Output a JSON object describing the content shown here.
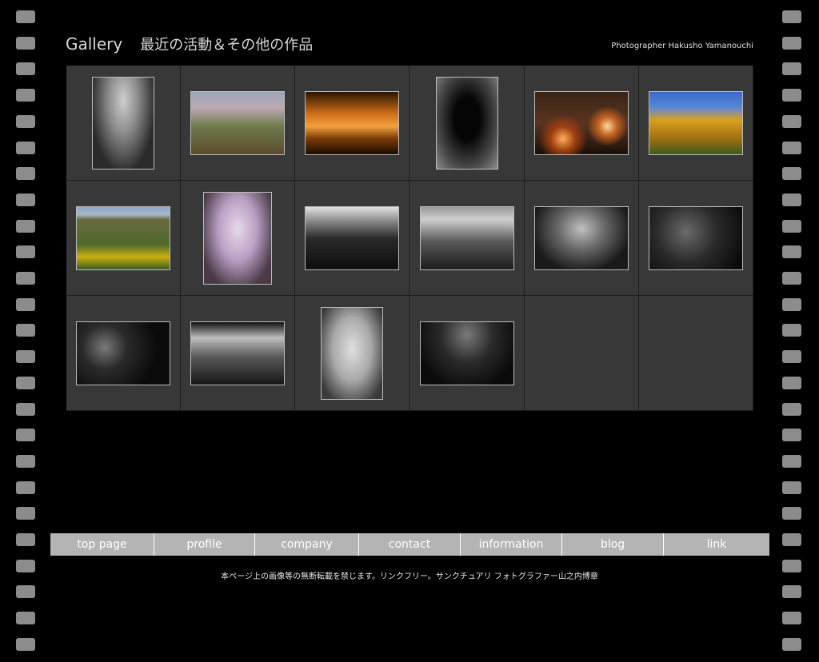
{
  "header": {
    "title": "Gallery",
    "subtitle": "最近の活動＆その他の作品",
    "photographer": "Photographer Hakusho Yamanouchi"
  },
  "gallery": {
    "thumbnails": [
      {
        "name": "bird-on-rubble-photo",
        "orientation": "portrait"
      },
      {
        "name": "village-blossom-photo",
        "orientation": "landscape"
      },
      {
        "name": "sunset-boat-photo",
        "orientation": "landscape"
      },
      {
        "name": "silhouette-tree-photo",
        "orientation": "portrait"
      },
      {
        "name": "lantern-festival-photo",
        "orientation": "landscape"
      },
      {
        "name": "ginkgo-tree-photo",
        "orientation": "landscape"
      },
      {
        "name": "flower-field-photo",
        "orientation": "landscape"
      },
      {
        "name": "cherry-tree-photo",
        "orientation": "portrait"
      },
      {
        "name": "debris-field-photo",
        "orientation": "landscape"
      },
      {
        "name": "ruined-building-photo",
        "orientation": "landscape"
      },
      {
        "name": "wrecked-shore-photo",
        "orientation": "landscape"
      },
      {
        "name": "rubble-closeup-photo",
        "orientation": "landscape"
      },
      {
        "name": "broken-pots-photo",
        "orientation": "landscape"
      },
      {
        "name": "devastated-town-photo",
        "orientation": "landscape"
      },
      {
        "name": "man-in-usa-shirt-photo",
        "orientation": "portrait"
      },
      {
        "name": "tangled-wire-photo",
        "orientation": "landscape"
      }
    ]
  },
  "nav": {
    "items": [
      "top page",
      "profile",
      "company",
      "contact",
      "information",
      "blog",
      "link"
    ]
  },
  "footer": {
    "text": "本ページ上の画像等の無断転載を禁じます。リンクフリー。サンクチュアリ フォトグラファー山之内博章"
  },
  "colors": {
    "background": "#000000",
    "grid_cell": "#383838",
    "nav_bar": "#b4b4b4",
    "film_perforation": "#8c8c8c"
  }
}
